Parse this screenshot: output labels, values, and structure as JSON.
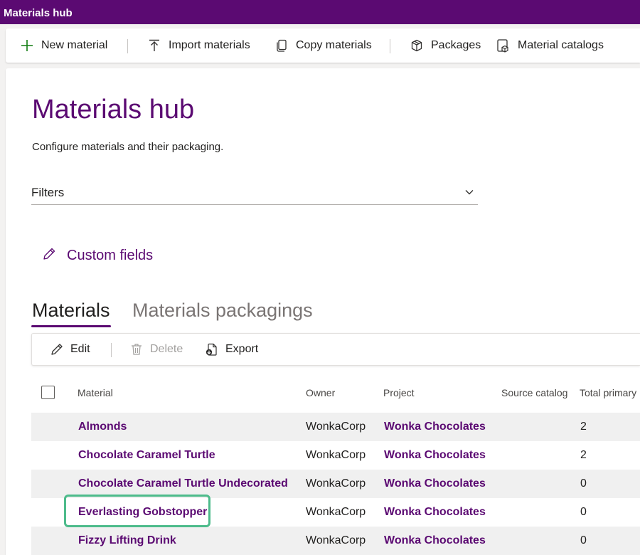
{
  "app": {
    "title": "Materials hub"
  },
  "commands": {
    "new_material": "New material",
    "import_materials": "Import materials",
    "copy_materials": "Copy materials",
    "packages": "Packages",
    "material_catalogs": "Material catalogs"
  },
  "page": {
    "title": "Materials hub",
    "description": "Configure materials and their packaging."
  },
  "filters": {
    "label": "Filters"
  },
  "custom_fields": {
    "label": "Custom fields"
  },
  "tabs": [
    {
      "label": "Materials",
      "active": true
    },
    {
      "label": "Materials packagings",
      "active": false
    }
  ],
  "grid_toolbar": {
    "edit": "Edit",
    "delete": "Delete",
    "export": "Export"
  },
  "table": {
    "columns": [
      "Material",
      "Owner",
      "Project",
      "Source catalog",
      "Total primary"
    ],
    "rows": [
      {
        "material": "Almonds",
        "owner": "WonkaCorp",
        "project": "Wonka Chocolates",
        "source_catalog": "",
        "total_primary": "2"
      },
      {
        "material": "Chocolate Caramel Turtle",
        "owner": "WonkaCorp",
        "project": "Wonka Chocolates",
        "source_catalog": "",
        "total_primary": "2"
      },
      {
        "material": "Chocolate Caramel Turtle Undecorated",
        "owner": "WonkaCorp",
        "project": "Wonka Chocolates",
        "source_catalog": "",
        "total_primary": "0"
      },
      {
        "material": "Everlasting Gobstopper",
        "owner": "WonkaCorp",
        "project": "Wonka Chocolates",
        "source_catalog": "",
        "total_primary": "0"
      },
      {
        "material": "Fizzy Lifting Drink",
        "owner": "WonkaCorp",
        "project": "Wonka Chocolates",
        "source_catalog": "",
        "total_primary": "0"
      }
    ]
  },
  "colors": {
    "brand": "#5b0a72",
    "highlight": "#4dbb8b",
    "row_alt": "#f0f0f0"
  },
  "icons": {
    "new_material": "plus-icon",
    "import_materials": "upload-icon",
    "copy_materials": "copy-icon",
    "packages": "package-icon",
    "material_catalogs": "catalog-icon",
    "filters": "chevron-down-icon",
    "custom_fields": "pencil-icon",
    "edit": "pencil-icon",
    "delete": "trash-icon",
    "export": "export-icon"
  }
}
